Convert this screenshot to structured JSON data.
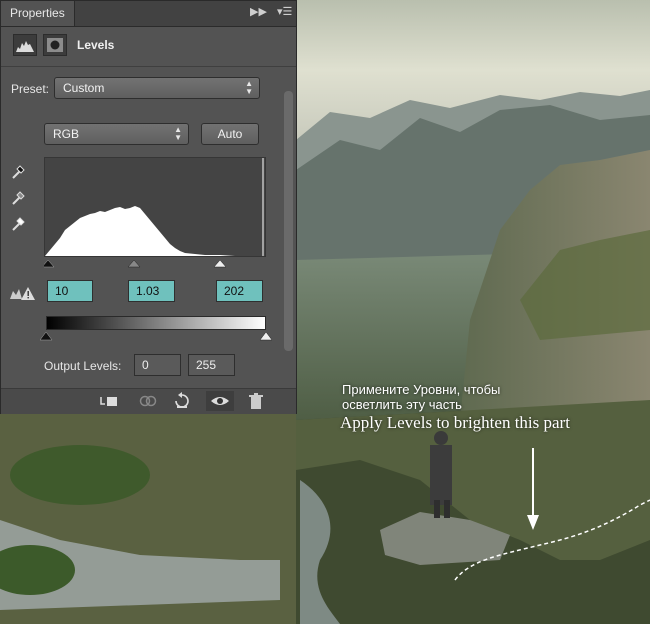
{
  "panel": {
    "tab_label": "Properties",
    "title": "Levels",
    "preset_label": "Preset:",
    "preset_value": "Custom",
    "channel_value": "RGB",
    "auto_label": "Auto",
    "input_levels": {
      "black": "10",
      "gamma": "1.03",
      "white": "202"
    },
    "output_label": "Output Levels:",
    "output_levels": {
      "black": "0",
      "white": "255"
    },
    "accent_color": "#6fc1bd"
  },
  "annotation": {
    "ru_line1": "Примените Уровни, чтобы",
    "ru_line2": "осветлить эту часть",
    "en": "Apply Levels to brighten this part"
  }
}
